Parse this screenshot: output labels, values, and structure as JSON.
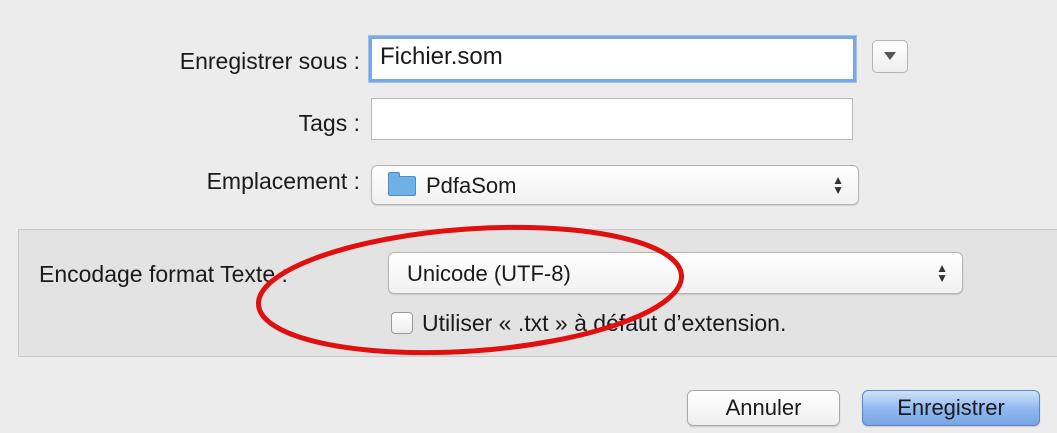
{
  "form": {
    "save_as_label": "Enregistrer sous :",
    "save_as_value": "Fichier.som",
    "tags_label": "Tags :",
    "tags_value": "",
    "location_label": "Emplacement :",
    "location_value": "PdfaSom"
  },
  "options": {
    "encoding_label": "Encodage format Texte :",
    "encoding_value": "Unicode (UTF-8)",
    "txt_checkbox_label": "Utiliser « .txt » à défaut d’extension.",
    "txt_checkbox_checked": false
  },
  "buttons": {
    "cancel": "Annuler",
    "save": "Enregistrer"
  },
  "icons": {
    "expand": "chevron-down-icon",
    "folder": "folder-icon",
    "stepper": "up-down-arrows-icon"
  },
  "colors": {
    "annotation_ellipse": "#e01010",
    "default_button": "#7aa4e6",
    "focus_ring": "#7aa7e8",
    "folder": "#6fb0e6"
  }
}
